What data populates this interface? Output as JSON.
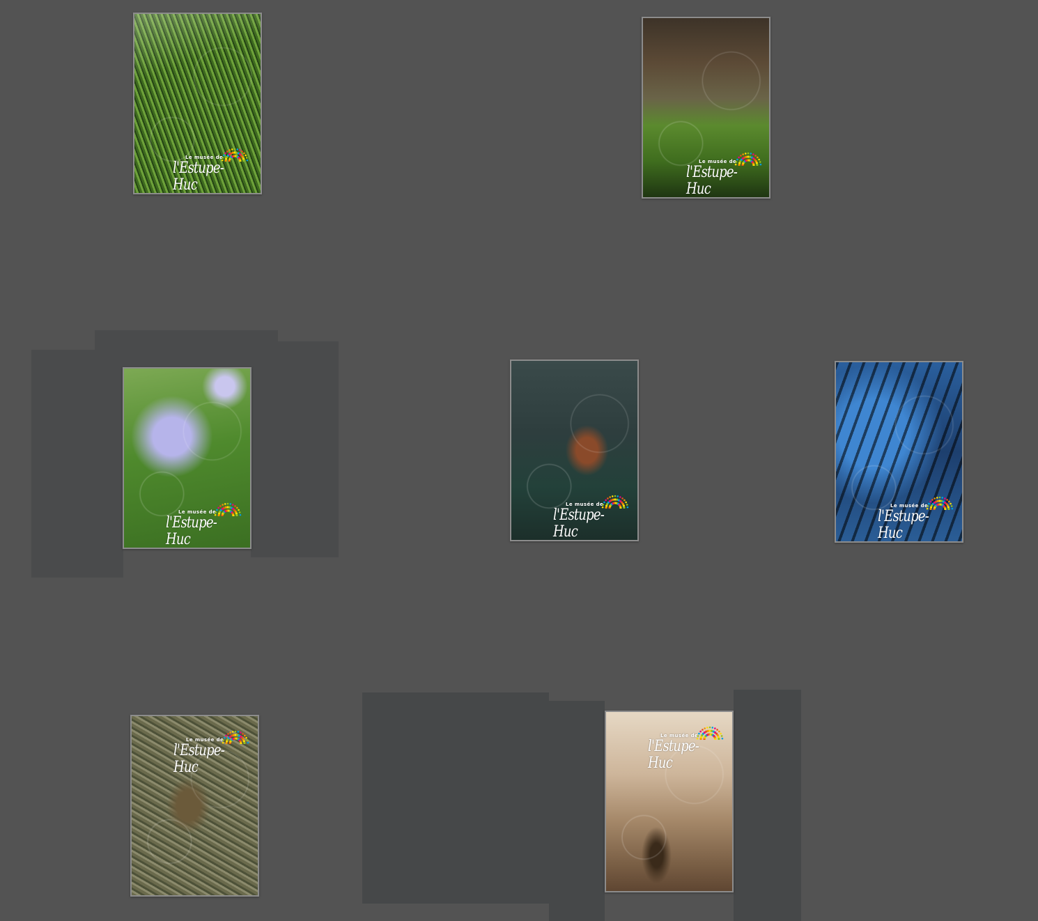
{
  "logo": {
    "subtitle": "Le musée de",
    "title": "l'Estupe-Huc",
    "fan_colors": [
      "#e94e1b",
      "#f39200",
      "#ffde00",
      "#95c11f",
      "#009fe3",
      "#e6007e"
    ]
  },
  "cards": [
    {
      "name": "pine-needles",
      "swirl": "#ffffff"
    },
    {
      "name": "hare-in-meadow",
      "swirl": "#ffffff"
    },
    {
      "name": "anemone-flower",
      "swirl": "#ffffff"
    },
    {
      "name": "red-squirrel",
      "swirl": "#ffffff"
    },
    {
      "name": "blue-tree-silhouette",
      "swirl": "#ffffff"
    },
    {
      "name": "pine-cone-moss",
      "swirl": "#ffffff"
    },
    {
      "name": "sepia-child-running",
      "swirl": "#ffffff"
    }
  ]
}
